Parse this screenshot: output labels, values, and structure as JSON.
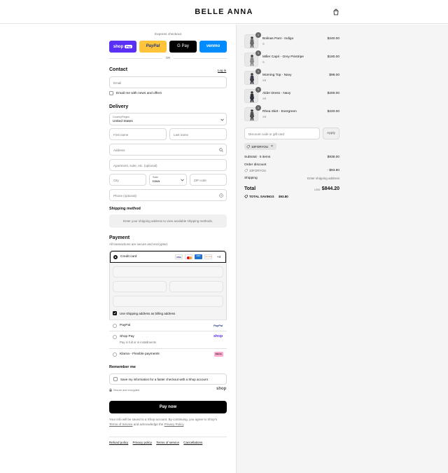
{
  "header": {
    "brand": "BELLE ANNA",
    "bag_icon": "shopping-bag-icon"
  },
  "express": {
    "label": "Express checkout",
    "shop": "shop",
    "shop_pay": "Pay",
    "paypal": "PayPal",
    "gpay": "G Pay",
    "venmo": "venmo",
    "or": "OR"
  },
  "contact": {
    "title": "Contact",
    "login": "Log in",
    "email_placeholder": "Email",
    "news_label": "Email me with news and offers"
  },
  "delivery": {
    "title": "Delivery",
    "country_label": "Country/Region",
    "country_value": "United States",
    "first_name": "First name",
    "last_name": "Last name",
    "address": "Address",
    "apartment": "Apartment, suite, etc. (optional)",
    "city": "City",
    "state_label": "State",
    "state_value": "Iowa",
    "zip": "ZIP code",
    "phone": "Phone (optional)"
  },
  "shipping": {
    "title": "Shipping method",
    "placeholder": "Enter your shipping address to view available shipping methods."
  },
  "payment": {
    "title": "Payment",
    "subtitle": "All transactions are secure and encrypted.",
    "credit_card": "Credit card",
    "card_visa": "VISA",
    "card_amex": "AMEX",
    "card_discover": "DISCOVER",
    "more_cards": "+4",
    "billing_label": "Use shipping address as billing address",
    "paypal": "PayPal",
    "paypal_logo": "PayPal",
    "shoppay": "Shop Pay",
    "shoppay_sub": "Pay in full or in installments",
    "shoppay_logo": "shop",
    "klarna": "Klarna - Flexible payments",
    "klarna_logo": "Klarna."
  },
  "remember": {
    "title": "Remember me",
    "save_label": "Save my information for a faster checkout with a Shop account",
    "secure": "Secure and encrypted",
    "shop_logo": "shop"
  },
  "pay_button": "Pay now",
  "legal": {
    "line1": "Your info will be saved to a Shop account. By continuing, you agree to Shop's",
    "tos": "Terms of Service",
    "and": "and acknowledge the",
    "privacy": "Privacy Policy",
    "period": "."
  },
  "footer_links": [
    "Refund policy",
    "Privacy policy",
    "Terms of service",
    "Cancellations"
  ],
  "cart": {
    "items": [
      {
        "qty": "1",
        "name": "Bolinas Pant - Indigo",
        "variant": "S",
        "price": "$240.00"
      },
      {
        "qty": "1",
        "name": "Miller Capri - Grey Pinstripe",
        "variant": "S",
        "price": "$180.00"
      },
      {
        "qty": "1",
        "name": "Morning Top - Navy",
        "variant": "XS",
        "price": "$98.00"
      },
      {
        "qty": "1",
        "name": "Alder Dress - Navy",
        "variant": "XS",
        "price": "$200.00"
      },
      {
        "qty": "1",
        "name": "Rhea Skirt - Evergreen",
        "variant": "XS",
        "price": "$220.00"
      }
    ]
  },
  "discount": {
    "placeholder": "Discount code or gift card",
    "apply": "Apply",
    "code": "10FORYOU"
  },
  "summary": {
    "subtotal_label": "Subtotal · 5 items",
    "subtotal": "$938.00",
    "order_discount": "Order discount",
    "discount_code": "10FORYOU",
    "discount_value": "- $93.80",
    "shipping_label": "Shipping",
    "shipping_value": "Enter shipping address",
    "total_label": "Total",
    "currency": "USD",
    "total": "$844.20",
    "savings_label": "TOTAL SAVINGS",
    "savings": "$93.80"
  },
  "colors": {
    "shop": "#5a31f4",
    "paypal": "#ffc439",
    "gpay": "#000000",
    "venmo": "#008cff",
    "button": "#000000"
  }
}
